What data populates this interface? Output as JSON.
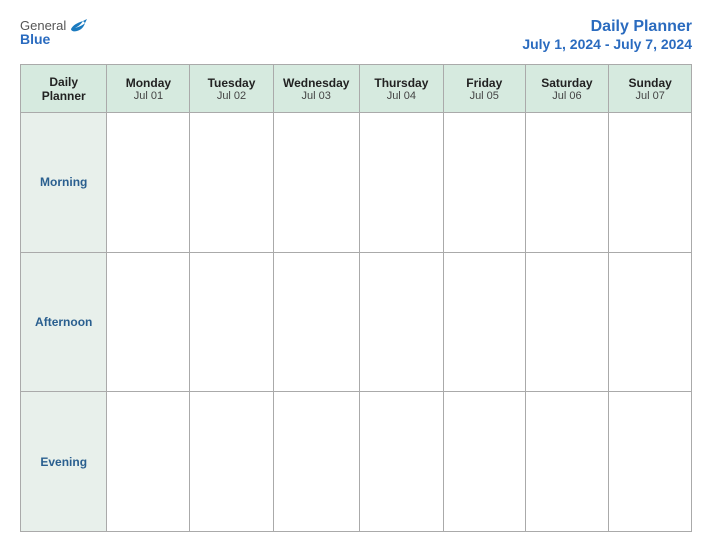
{
  "logo": {
    "general": "General",
    "blue": "Blue"
  },
  "header": {
    "title": "Daily Planner",
    "date_range": "July 1, 2024 - July 7, 2024"
  },
  "columns": [
    {
      "name": "Daily Planner",
      "date": ""
    },
    {
      "name": "Monday",
      "date": "Jul 01"
    },
    {
      "name": "Tuesday",
      "date": "Jul 02"
    },
    {
      "name": "Wednesday",
      "date": "Jul 03"
    },
    {
      "name": "Thursday",
      "date": "Jul 04"
    },
    {
      "name": "Friday",
      "date": "Jul 05"
    },
    {
      "name": "Saturday",
      "date": "Jul 06"
    },
    {
      "name": "Sunday",
      "date": "Jul 07"
    }
  ],
  "rows": [
    {
      "label": "Morning"
    },
    {
      "label": "Afternoon"
    },
    {
      "label": "Evening"
    }
  ]
}
